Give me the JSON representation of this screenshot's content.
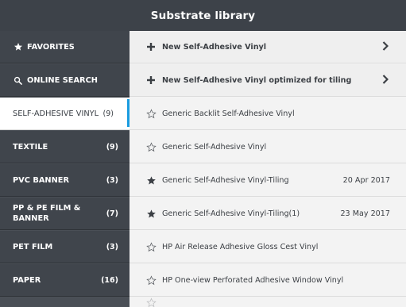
{
  "header": {
    "title": "Substrate library"
  },
  "sidebar": {
    "items": [
      {
        "label": "FAVORITES",
        "icon": "star-icon",
        "count": ""
      },
      {
        "label": "ONLINE SEARCH",
        "icon": "search-icon",
        "count": ""
      },
      {
        "label": "SELF-ADHESIVE VINYL",
        "count": "(9)",
        "selected": true
      },
      {
        "label": "TEXTILE",
        "count": "(9)"
      },
      {
        "label": "PVC BANNER",
        "count": "(3)"
      },
      {
        "label": "PP & PE FILM & BANNER",
        "count": "(7)"
      },
      {
        "label": "PET FILM",
        "count": "(3)"
      },
      {
        "label": "PAPER",
        "count": "(16)"
      }
    ]
  },
  "main": {
    "rows": [
      {
        "label": "New Self-Adhesive Vinyl",
        "icon": "plus-icon",
        "date": "",
        "chevron": true
      },
      {
        "label": "New Self-Adhesive Vinyl optimized for tiling",
        "icon": "plus-icon",
        "date": "",
        "chevron": true
      },
      {
        "label": "Generic Backlit Self-Adhesive Vinyl",
        "icon": "star-outline-icon",
        "date": ""
      },
      {
        "label": "Generic Self-Adhesive Vinyl",
        "icon": "star-outline-icon",
        "date": ""
      },
      {
        "label": "Generic Self-Adhesive Vinyl-Tiling",
        "icon": "star-filled-icon",
        "date": "20 Apr 2017"
      },
      {
        "label": "Generic Self-Adhesive Vinyl-Tiling(1)",
        "icon": "star-filled-icon",
        "date": "23 May 2017"
      },
      {
        "label": "HP Air Release Adhesive Gloss Cest Vinyl",
        "icon": "star-outline-icon",
        "date": ""
      },
      {
        "label": "HP One-view Perforated Adhesive Window Vinyl",
        "icon": "star-outline-icon",
        "date": ""
      }
    ]
  },
  "colors": {
    "header_bg": "#3d4249",
    "sidebar_bg": "#40454c",
    "accent": "#1a9ce0",
    "main_bg": "#f3f3f3"
  }
}
